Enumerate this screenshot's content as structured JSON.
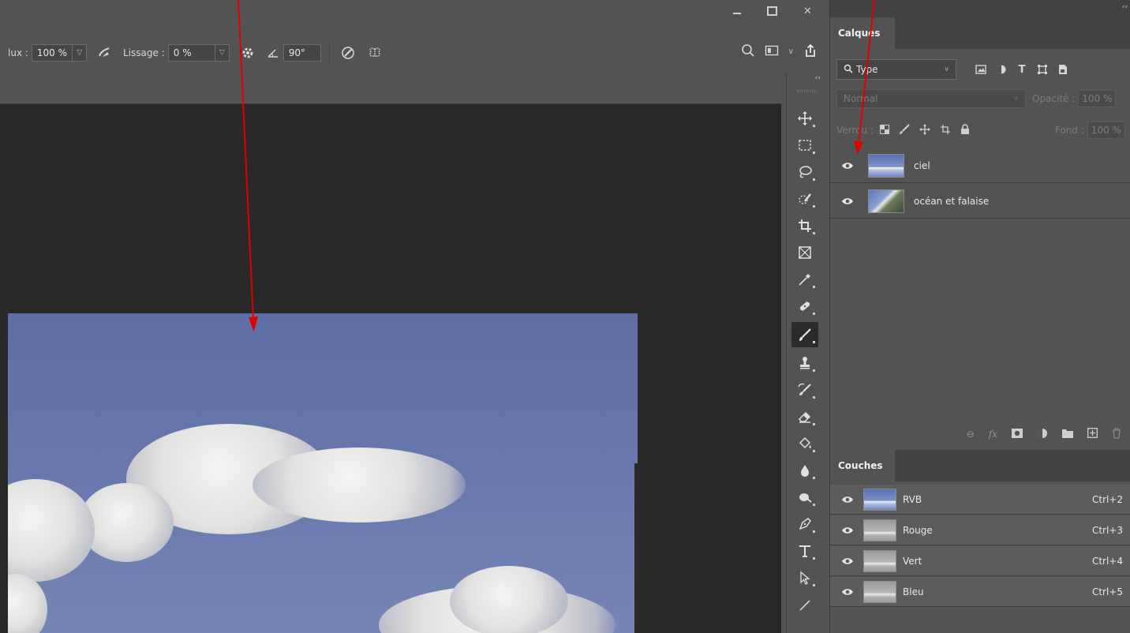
{
  "colors": {
    "annotation_arrow": "#e00000",
    "canvas_bg": "#282828",
    "ui_bg": "#535353",
    "panel_dark": "#424242"
  },
  "window": {
    "minimize": "",
    "maximize": "",
    "close": "✕"
  },
  "options_bar": {
    "flow_label": "lux :",
    "flow_value": "100 %",
    "smoothing_label": "Lissage :",
    "smoothing_value": "0 %",
    "angle_value": "90°"
  },
  "layers_panel": {
    "tab_label": "Calques",
    "filter_type": "Type",
    "blend_mode": "Normal",
    "opacity_label": "Opacité :",
    "opacity_value": "100 %",
    "lock_label": "Verrou :",
    "fill_label": "Fond :",
    "fill_value": "100 %",
    "layers": [
      {
        "name": "ciel",
        "thumb": "sky"
      },
      {
        "name": "océan et falaise",
        "thumb": "sea"
      }
    ]
  },
  "channels_panel": {
    "tab_label": "Couches",
    "channels": [
      {
        "name": "RVB",
        "shortcut": "Ctrl+2"
      },
      {
        "name": "Rouge",
        "shortcut": "Ctrl+3"
      },
      {
        "name": "Vert",
        "shortcut": "Ctrl+4"
      },
      {
        "name": "Bleu",
        "shortcut": "Ctrl+5"
      }
    ]
  },
  "tools": [
    "move-tool",
    "marquee-tool",
    "lasso-tool",
    "quick-selection-tool",
    "crop-tool",
    "frame-tool",
    "eyedropper-tool",
    "healing-brush-tool",
    "brush-tool",
    "clone-stamp-tool",
    "history-brush-tool",
    "eraser-tool",
    "paint-bucket-tool",
    "blur-tool",
    "dodge-tool",
    "pen-tool",
    "type-tool",
    "path-selection-tool",
    "line-tool"
  ],
  "active_tool": "brush-tool"
}
